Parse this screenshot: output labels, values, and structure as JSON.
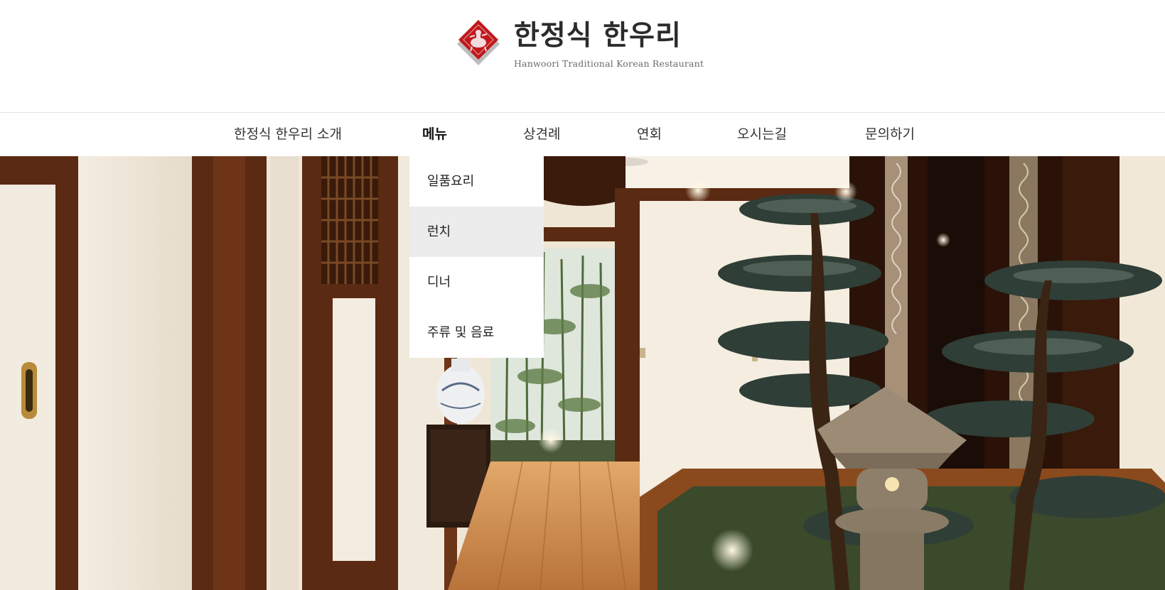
{
  "brand": {
    "title": "한정식 한우리",
    "subtitle": "Hanwoori Traditional Korean Restaurant",
    "accent_color": "#c0181c",
    "logo_icon": "diamond-emblem-icon"
  },
  "nav": {
    "items": [
      {
        "label": "한정식 한우리 소개"
      },
      {
        "label": "메뉴",
        "active": true
      },
      {
        "label": "상견례"
      },
      {
        "label": "연회"
      },
      {
        "label": "오시는길"
      },
      {
        "label": "문의하기"
      }
    ]
  },
  "dropdown": {
    "items": [
      {
        "label": "일품요리"
      },
      {
        "label": "런치",
        "hovered": true
      },
      {
        "label": "디너"
      },
      {
        "label": "주류 및 음료"
      }
    ]
  },
  "hero": {
    "image": "restaurant-interior-photo"
  }
}
